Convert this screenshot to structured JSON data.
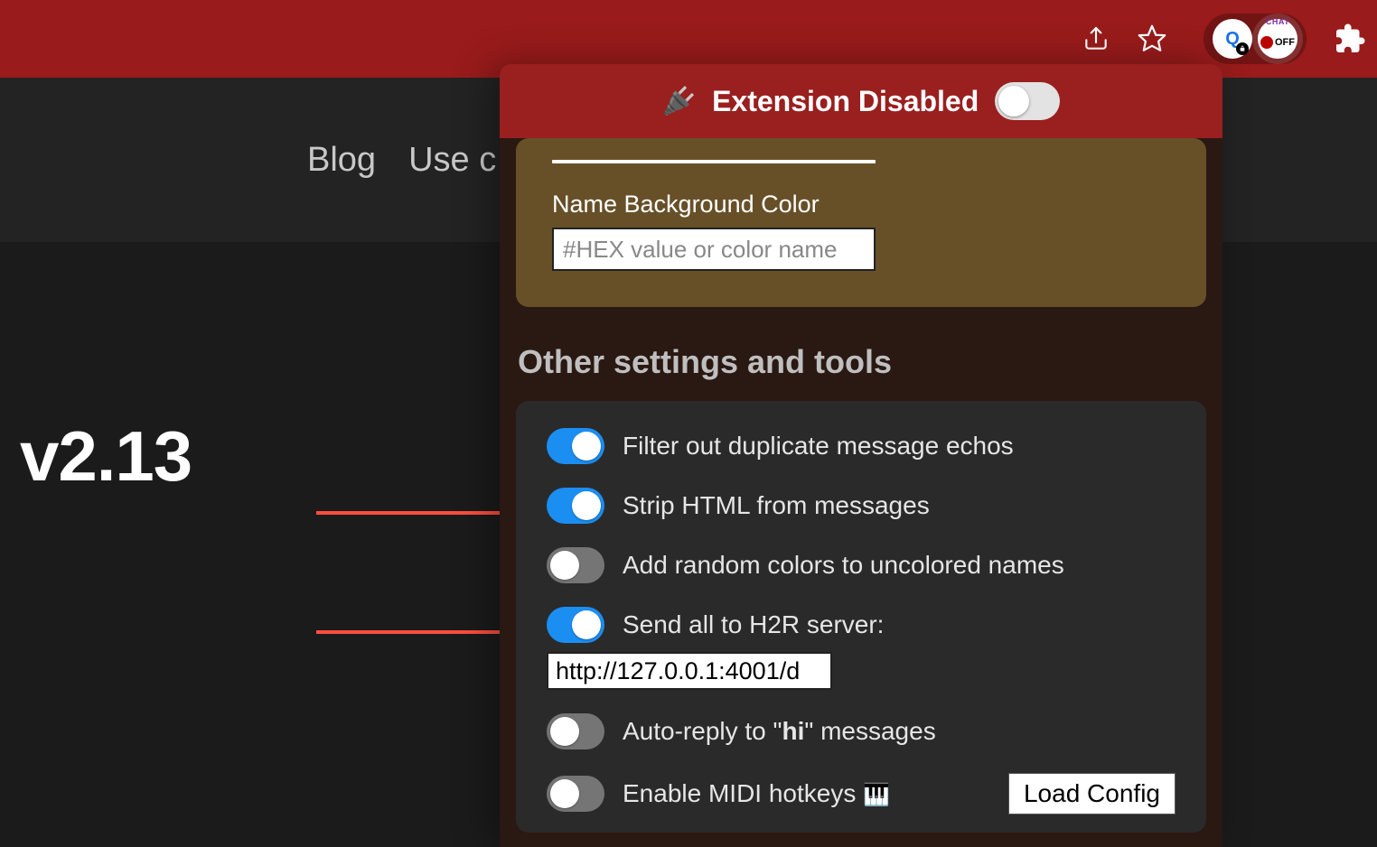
{
  "chrome": {
    "ext_pill_1_label": "Q",
    "ext_pill_2_minilabel": "CHAT",
    "ext_pill_2_off": "OFF"
  },
  "site_nav": {
    "item_blog": "Blog",
    "item_use": "Use c"
  },
  "page": {
    "version": "v2.13"
  },
  "popup": {
    "header_text": "Extension Disabled",
    "header_plug": "🔌",
    "name_bg_label": "Name Background Color",
    "name_bg_placeholder": "#HEX value or color name",
    "section_title": "Other settings and tools",
    "opts": {
      "filter_echos": "Filter out duplicate message echos",
      "strip_html": "Strip HTML from messages",
      "random_colors": "Add random colors to uncolored names",
      "h2r": "Send all to H2R server:",
      "h2r_value": "http://127.0.0.1:4001/d",
      "auto_reply_prefix": "Auto-reply to \"",
      "auto_reply_keyword": "hi",
      "auto_reply_suffix": "\" messages",
      "midi": "Enable MIDI hotkeys",
      "midi_emoji": "🎹",
      "load_config": "Load Config"
    }
  }
}
